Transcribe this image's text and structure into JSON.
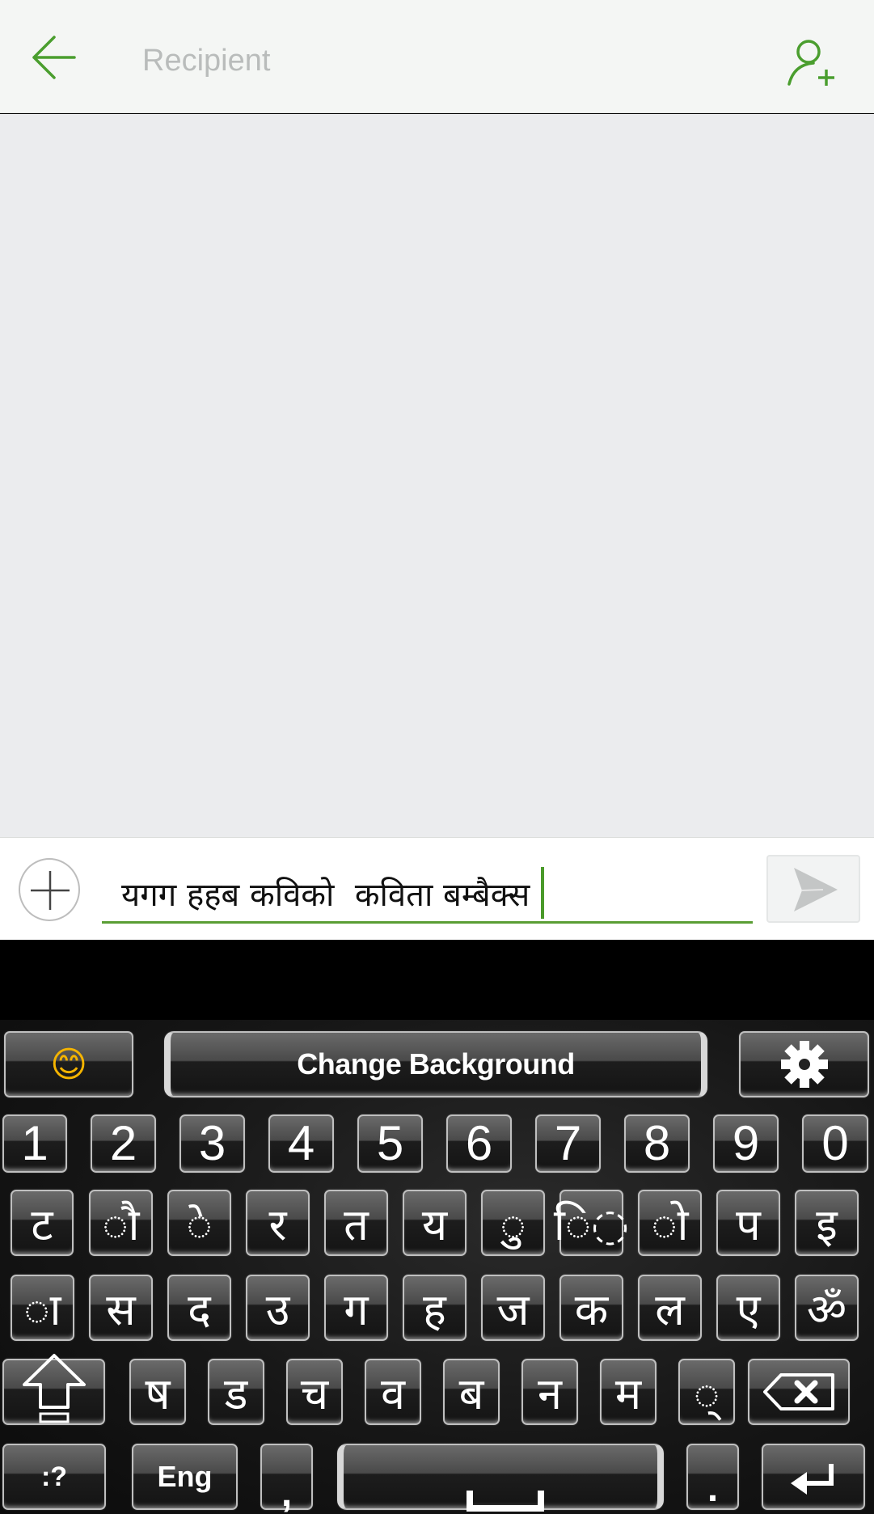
{
  "header": {
    "back_icon": "arrow-left-icon",
    "recipient_placeholder": "Recipient",
    "add_contact_icon": "person-add-icon",
    "accent_color": "#4a9e2e"
  },
  "compose": {
    "attach_icon": "plus-icon",
    "message_value": "यगग हहब कविको  कविता बम्बैक्स",
    "send_icon": "send-icon"
  },
  "keyboard": {
    "toolbar": {
      "emoji_icon": "smiley-emoji-icon",
      "emoji_glyph": "😊",
      "change_background_label": "Change Background",
      "settings_icon": "gear-icon",
      "settings_glyph": "⚙"
    },
    "row_numbers": [
      "1",
      "2",
      "3",
      "4",
      "5",
      "6",
      "7",
      "8",
      "9",
      "0"
    ],
    "row_1": [
      "ट",
      "◌ौ",
      "◌े",
      "र",
      "त",
      "य",
      "◌ु",
      "ि◌",
      "◌ो",
      "प",
      "इ"
    ],
    "row_2": [
      "◌ा",
      "स",
      "द",
      "उ",
      "ग",
      "ह",
      "ज",
      "क",
      "ल",
      "ए",
      "ॐ"
    ],
    "row_3": {
      "shift_icon": "shift-arrow-icon",
      "keys": [
        "ष",
        "ड",
        "च",
        "व",
        "ब",
        "न",
        "म",
        "◌्"
      ],
      "backspace_icon": "backspace-icon"
    },
    "bottom_row": {
      "symbols_label": ":?",
      "language_label": "Eng",
      "comma_label": ",",
      "space_icon": "space-bar-icon",
      "period_label": ".",
      "enter_icon": "enter-return-icon"
    }
  }
}
